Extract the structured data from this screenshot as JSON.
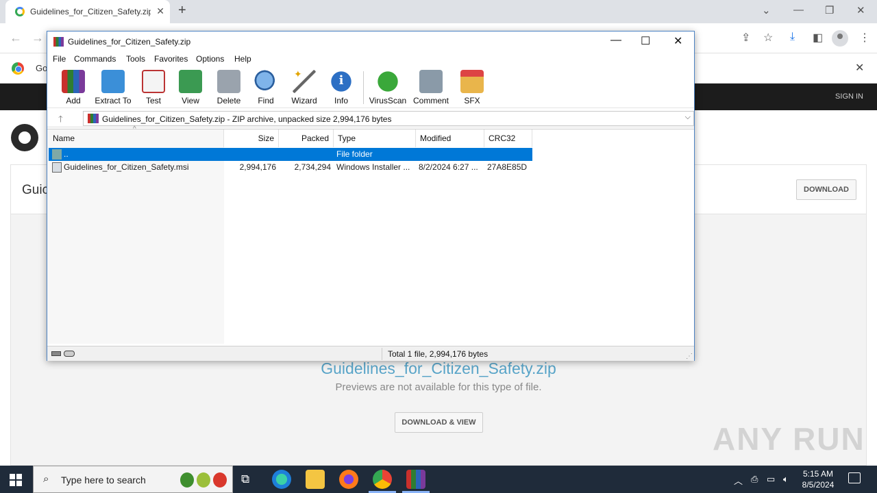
{
  "browser": {
    "tab_title": "Guidelines_for_Citizen_Safety.zip",
    "tab_close": "✕",
    "new_tab": "+",
    "infobar_text": "Go",
    "infobar_close": "✕"
  },
  "site": {
    "signin": "SIGN IN",
    "page_title": "Guic",
    "download_label": "DOWNLOAD",
    "file_name": "Guidelines_for_Citizen_Safety.zip",
    "preview_message": "Previews are not available for this type of file.",
    "download_view_label": "DOWNLOAD & VIEW",
    "watermark": "ANY RUN"
  },
  "winrar": {
    "title": "Guidelines_for_Citizen_Safety.zip",
    "menu": [
      "File",
      "Commands",
      "Tools",
      "Favorites",
      "Options",
      "Help"
    ],
    "toolbar": [
      "Add",
      "Extract To",
      "Test",
      "View",
      "Delete",
      "Find",
      "Wizard",
      "Info",
      "VirusScan",
      "Comment",
      "SFX"
    ],
    "address": "Guidelines_for_Citizen_Safety.zip - ZIP archive, unpacked size 2,994,176 bytes",
    "columns": [
      "Name",
      "Size",
      "Packed",
      "Type",
      "Modified",
      "CRC32"
    ],
    "rows": [
      {
        "name": "..",
        "size": "",
        "packed": "",
        "type": "File folder",
        "modified": "",
        "crc": ""
      },
      {
        "name": "Guidelines_for_Citizen_Safety.msi",
        "size": "2,994,176",
        "packed": "2,734,294",
        "type": "Windows Installer ...",
        "modified": "8/2/2024 6:27 ...",
        "crc": "27A8E85D"
      }
    ],
    "status": "Total 1 file, 2,994,176 bytes"
  },
  "taskbar": {
    "search_placeholder": "Type here to search",
    "time": "5:15 AM",
    "date": "8/5/2024"
  },
  "colors": {
    "selection": "#0078d7",
    "taskbar": "#1f2b3a",
    "site_header": "#1c1c1c",
    "link_blue": "#58a4c8"
  }
}
